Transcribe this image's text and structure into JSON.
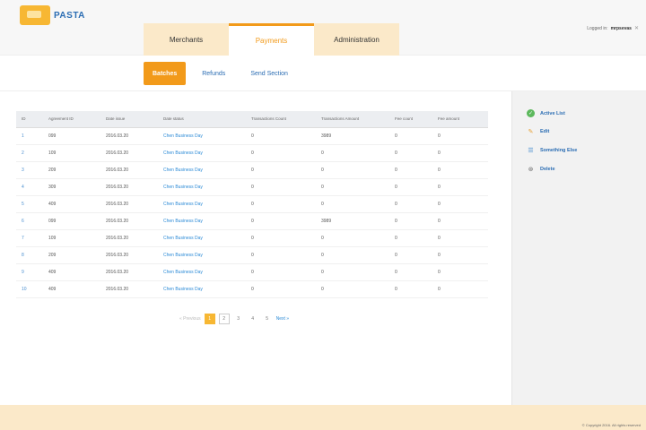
{
  "brand": {
    "logo_text": "PASTA"
  },
  "header": {
    "tabs": [
      {
        "label": "Merchants"
      },
      {
        "label": "Payments",
        "active": true
      },
      {
        "label": "Administration"
      }
    ],
    "user": {
      "prefix": "Logged in:",
      "name": "mrpsevas",
      "logout_icon": "logout-icon"
    }
  },
  "subnav": {
    "tabs": [
      {
        "label": "Batches",
        "active": true
      },
      {
        "label": "Refunds"
      },
      {
        "label": "Send Section"
      }
    ]
  },
  "table": {
    "columns": [
      "ID",
      "Agreement ID",
      "Date issue",
      "Date status",
      "Transactions Count",
      "Transactions Amount",
      "Fee count",
      "Fee amount"
    ],
    "rows": [
      [
        "1",
        "099",
        "2016.03.20",
        "Chen Business Day",
        "0",
        "3989",
        "0",
        "0"
      ],
      [
        "2",
        "109",
        "2016.03.20",
        "Chen Business Day",
        "0",
        "0",
        "0",
        "0"
      ],
      [
        "3",
        "209",
        "2016.03.20",
        "Chen Business Day",
        "0",
        "0",
        "0",
        "0"
      ],
      [
        "4",
        "309",
        "2016.03.20",
        "Chen Business Day",
        "0",
        "0",
        "0",
        "0"
      ],
      [
        "5",
        "409",
        "2016.03.20",
        "Chen Business Day",
        "0",
        "0",
        "0",
        "0"
      ],
      [
        "6",
        "099",
        "2016.03.20",
        "Chen Business Day",
        "0",
        "3989",
        "0",
        "0"
      ],
      [
        "7",
        "109",
        "2016.03.20",
        "Chen Business Day",
        "0",
        "0",
        "0",
        "0"
      ],
      [
        "8",
        "209",
        "2016.03.20",
        "Chen Business Day",
        "0",
        "0",
        "0",
        "0"
      ],
      [
        "9",
        "409",
        "2016.03.20",
        "Chen Business Day",
        "0",
        "0",
        "0",
        "0"
      ],
      [
        "10",
        "409",
        "2016.03.20",
        "Chen Business Day",
        "0",
        "0",
        "0",
        "0"
      ]
    ]
  },
  "pager": {
    "prev_label": "« Previous",
    "pages": [
      "1",
      "2",
      "3",
      "4",
      "5"
    ],
    "current": "1",
    "next_label": "Next »"
  },
  "sidebar": {
    "actions": [
      {
        "label": "Active List",
        "icon": "check-icon"
      },
      {
        "label": "Edit",
        "icon": "edit-icon"
      },
      {
        "label": "Something Else",
        "icon": "list-icon"
      },
      {
        "label": "Delete",
        "icon": "delete-icon"
      }
    ]
  },
  "footer": {
    "text": "© Copyright 2016. All rights reserved"
  },
  "colors": {
    "accent": "#f29a1a",
    "brand_yellow": "#f7b733",
    "link": "#2b8ad6",
    "footer_bg": "#fbe9c9"
  }
}
